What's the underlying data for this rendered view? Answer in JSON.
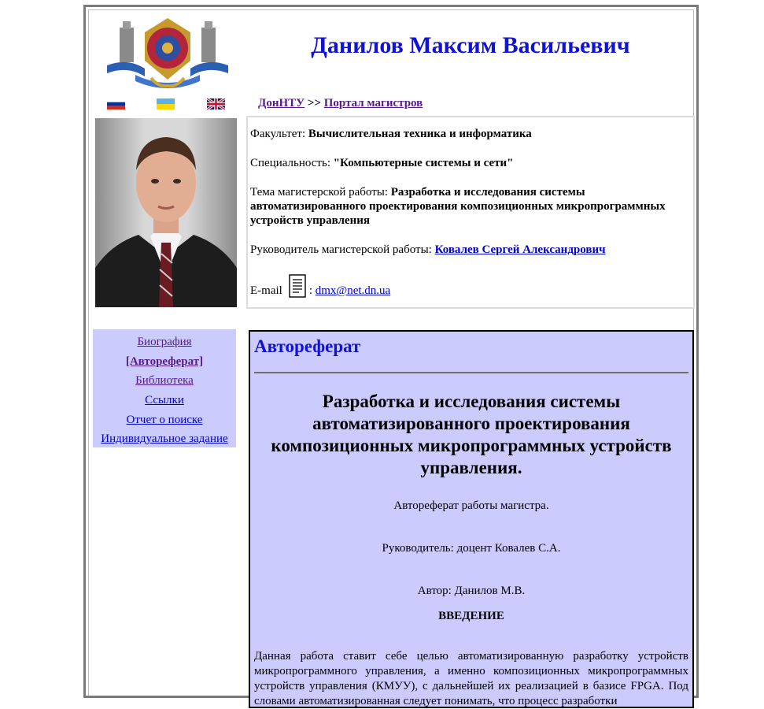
{
  "header": {
    "title": "Данилов Максим Васильевич",
    "breadcrumb_home": "ДонНТУ",
    "breadcrumb_sep": ">>",
    "breadcrumb_portal": "Портал магистров"
  },
  "languages": [
    "ru-flag",
    "ua-flag",
    "en-flag"
  ],
  "info": {
    "faculty_label": "Факультет:",
    "faculty_value": "Вычислительная техника и информатика",
    "specialty_label": "Специальность:",
    "specialty_value": "\"Компьютерные системы и сети\"",
    "thesis_label": "Тема магистерской работы:",
    "thesis_value": "Разработка и исследования системы автоматизированного проектирования композиционных микропрограммных устройств управления",
    "supervisor_label": "Руководитель магистерской работы:",
    "supervisor_value": "Ковалев Сергей Александрович",
    "email_label": "E-mail",
    "email_sep": ":",
    "email_value": "dmx@net.dn.ua"
  },
  "nav": {
    "biography": "Биография",
    "abstract": "[Автореферат]",
    "library": "Библиотека",
    "links": "Ссылки",
    "search_report": "Отчет о поиске",
    "individual_task": "Индивидуальное задание"
  },
  "abstract": {
    "heading": "Автореферат",
    "title": "Разработка и исследования системы автоматизированного проектирования композиционных микропрограммных устройств управления.",
    "note": "Автореферат работы магистра.",
    "supervisor": "Руководитель: доцент Ковалев С.А.",
    "author": "Автор: Данилов М.В.",
    "intro_heading": "ВВЕДЕНИЕ",
    "body": "Данная работа ставит себе целью автоматизированную разработку устройств микропрограммного управления, а именно композиционных микропрограммных устройств управления (КМУУ), с дальнейшей их реализацией в базисе FPGA. Под словами автоматизированная следует понимать, что процесс разработки"
  },
  "colors": {
    "title_blue": "#1212d2",
    "panel_lavender": "#cccbfd",
    "link_blue": "#0000cc",
    "visited_purple": "#551a8b"
  }
}
